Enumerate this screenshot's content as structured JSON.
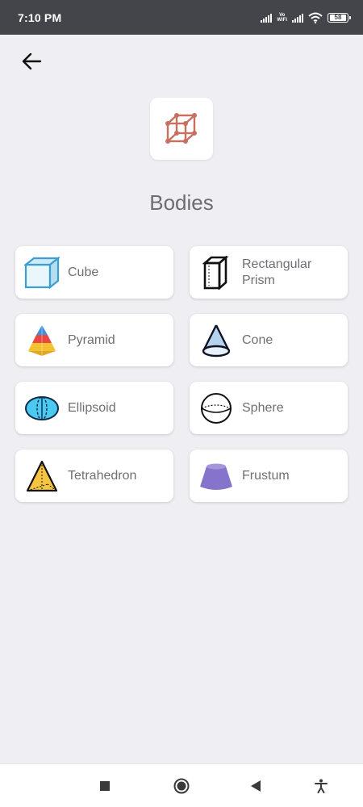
{
  "status_bar": {
    "time": "7:10 PM",
    "vowifi_line1": "Vo",
    "vowifi_line2": "WiFi",
    "battery": "58"
  },
  "header": {
    "back_icon": "arrow-left-icon",
    "category_icon": "wireframe-cube-icon",
    "title": "Bodies"
  },
  "bodies": [
    {
      "label": "Cube",
      "icon": "cube-icon"
    },
    {
      "label": "Rectangular Prism",
      "icon": "rectangular-prism-icon"
    },
    {
      "label": "Pyramid",
      "icon": "pyramid-icon"
    },
    {
      "label": "Cone",
      "icon": "cone-icon"
    },
    {
      "label": "Ellipsoid",
      "icon": "ellipsoid-icon"
    },
    {
      "label": "Sphere",
      "icon": "sphere-icon"
    },
    {
      "label": "Tetrahedron",
      "icon": "tetrahedron-icon"
    },
    {
      "label": "Frustum",
      "icon": "frustum-icon"
    }
  ],
  "nav_bar": {
    "icons": [
      "square-icon",
      "circle-icon",
      "triangle-back-icon",
      "accessibility-icon"
    ]
  },
  "colors": {
    "background": "#eeeef3",
    "status_bar": "#44454b",
    "card": "#ffffff",
    "text": "#6f6f74",
    "accent": "#c8705f"
  }
}
